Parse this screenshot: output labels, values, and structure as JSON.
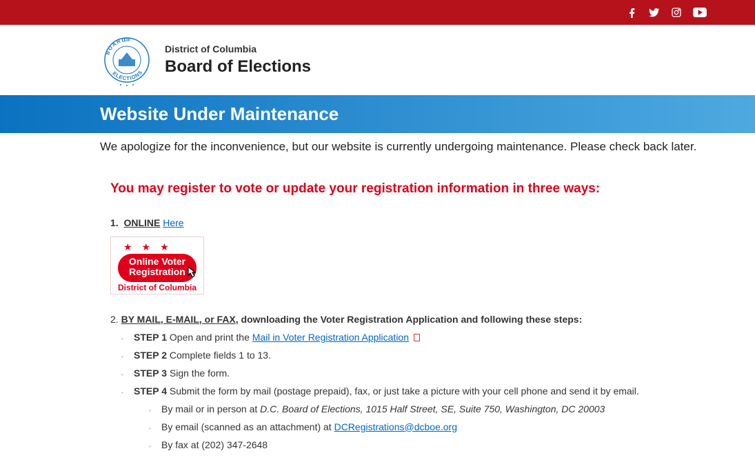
{
  "header": {
    "social": [
      "facebook",
      "twitter",
      "instagram",
      "youtube"
    ]
  },
  "brand": {
    "pretitle": "District of Columbia",
    "title": "Board of Elections",
    "seal_top": "BOARD",
    "seal_mid": "OF",
    "seal_bot": "ELECTIONS"
  },
  "banner": {
    "heading": "Website Under Maintenance",
    "subtext": "We apologize for the inconvenience, but our website is currently undergoing maintenance. Please check back later."
  },
  "content": {
    "intro": "You may register to vote or update your registration information in three ways:",
    "method1": {
      "num": "1.",
      "label": "ONLINE",
      "link_text": "Here",
      "button": {
        "line1": "Online Voter",
        "line2": "Registration",
        "dc": "District of Columbia"
      }
    },
    "method2": {
      "num": "2.",
      "label": "BY MAIL, E-MAIL, or FAX",
      "rest": ", downloading the Voter Registration Application and following these steps:",
      "steps": [
        {
          "label": "STEP 1",
          "text_before": " Open and print the  ",
          "link": "Mail in Voter Registration Application",
          "has_pdf": true
        },
        {
          "label": "STEP 2",
          "text_before": " Complete fields 1 to 13."
        },
        {
          "label": "STEP 3",
          "text_before": " Sign the form."
        },
        {
          "label": "STEP 4",
          "text_before": " Submit the form by mail (postage prepaid), fax, or just take a picture with your cell phone and send it by email."
        }
      ],
      "substeps": [
        {
          "prefix": "By mail or in person at  ",
          "italic": "D.C. Board of Elections, 1015 Half Street, SE, Suite 750, Washington, DC 20003"
        },
        {
          "prefix": "By email (scanned as an attachment) at  ",
          "link": "DCRegistrations@dcboe.org"
        },
        {
          "prefix": "By fax at (202) 347-2648"
        }
      ]
    }
  }
}
